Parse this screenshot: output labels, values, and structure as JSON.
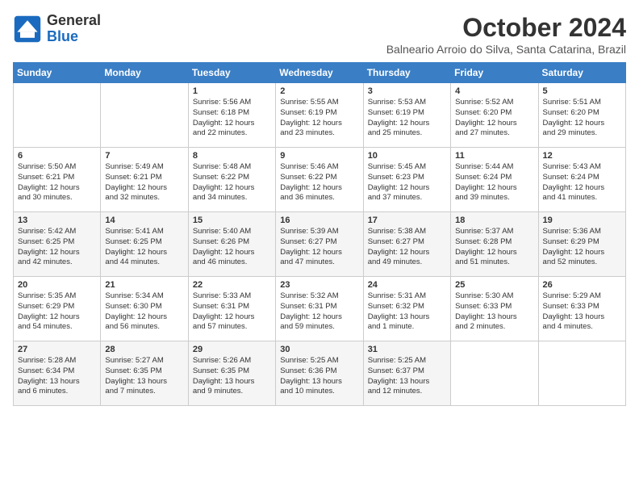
{
  "header": {
    "logo_text_general": "General",
    "logo_text_blue": "Blue",
    "month": "October 2024",
    "location": "Balneario Arroio do Silva, Santa Catarina, Brazil"
  },
  "days_of_week": [
    "Sunday",
    "Monday",
    "Tuesday",
    "Wednesday",
    "Thursday",
    "Friday",
    "Saturday"
  ],
  "weeks": [
    [
      {
        "day": "",
        "content": ""
      },
      {
        "day": "",
        "content": ""
      },
      {
        "day": "1",
        "content": "Sunrise: 5:56 AM\nSunset: 6:18 PM\nDaylight: 12 hours\nand 22 minutes."
      },
      {
        "day": "2",
        "content": "Sunrise: 5:55 AM\nSunset: 6:19 PM\nDaylight: 12 hours\nand 23 minutes."
      },
      {
        "day": "3",
        "content": "Sunrise: 5:53 AM\nSunset: 6:19 PM\nDaylight: 12 hours\nand 25 minutes."
      },
      {
        "day": "4",
        "content": "Sunrise: 5:52 AM\nSunset: 6:20 PM\nDaylight: 12 hours\nand 27 minutes."
      },
      {
        "day": "5",
        "content": "Sunrise: 5:51 AM\nSunset: 6:20 PM\nDaylight: 12 hours\nand 29 minutes."
      }
    ],
    [
      {
        "day": "6",
        "content": "Sunrise: 5:50 AM\nSunset: 6:21 PM\nDaylight: 12 hours\nand 30 minutes."
      },
      {
        "day": "7",
        "content": "Sunrise: 5:49 AM\nSunset: 6:21 PM\nDaylight: 12 hours\nand 32 minutes."
      },
      {
        "day": "8",
        "content": "Sunrise: 5:48 AM\nSunset: 6:22 PM\nDaylight: 12 hours\nand 34 minutes."
      },
      {
        "day": "9",
        "content": "Sunrise: 5:46 AM\nSunset: 6:22 PM\nDaylight: 12 hours\nand 36 minutes."
      },
      {
        "day": "10",
        "content": "Sunrise: 5:45 AM\nSunset: 6:23 PM\nDaylight: 12 hours\nand 37 minutes."
      },
      {
        "day": "11",
        "content": "Sunrise: 5:44 AM\nSunset: 6:24 PM\nDaylight: 12 hours\nand 39 minutes."
      },
      {
        "day": "12",
        "content": "Sunrise: 5:43 AM\nSunset: 6:24 PM\nDaylight: 12 hours\nand 41 minutes."
      }
    ],
    [
      {
        "day": "13",
        "content": "Sunrise: 5:42 AM\nSunset: 6:25 PM\nDaylight: 12 hours\nand 42 minutes."
      },
      {
        "day": "14",
        "content": "Sunrise: 5:41 AM\nSunset: 6:25 PM\nDaylight: 12 hours\nand 44 minutes."
      },
      {
        "day": "15",
        "content": "Sunrise: 5:40 AM\nSunset: 6:26 PM\nDaylight: 12 hours\nand 46 minutes."
      },
      {
        "day": "16",
        "content": "Sunrise: 5:39 AM\nSunset: 6:27 PM\nDaylight: 12 hours\nand 47 minutes."
      },
      {
        "day": "17",
        "content": "Sunrise: 5:38 AM\nSunset: 6:27 PM\nDaylight: 12 hours\nand 49 minutes."
      },
      {
        "day": "18",
        "content": "Sunrise: 5:37 AM\nSunset: 6:28 PM\nDaylight: 12 hours\nand 51 minutes."
      },
      {
        "day": "19",
        "content": "Sunrise: 5:36 AM\nSunset: 6:29 PM\nDaylight: 12 hours\nand 52 minutes."
      }
    ],
    [
      {
        "day": "20",
        "content": "Sunrise: 5:35 AM\nSunset: 6:29 PM\nDaylight: 12 hours\nand 54 minutes."
      },
      {
        "day": "21",
        "content": "Sunrise: 5:34 AM\nSunset: 6:30 PM\nDaylight: 12 hours\nand 56 minutes."
      },
      {
        "day": "22",
        "content": "Sunrise: 5:33 AM\nSunset: 6:31 PM\nDaylight: 12 hours\nand 57 minutes."
      },
      {
        "day": "23",
        "content": "Sunrise: 5:32 AM\nSunset: 6:31 PM\nDaylight: 12 hours\nand 59 minutes."
      },
      {
        "day": "24",
        "content": "Sunrise: 5:31 AM\nSunset: 6:32 PM\nDaylight: 13 hours\nand 1 minute."
      },
      {
        "day": "25",
        "content": "Sunrise: 5:30 AM\nSunset: 6:33 PM\nDaylight: 13 hours\nand 2 minutes."
      },
      {
        "day": "26",
        "content": "Sunrise: 5:29 AM\nSunset: 6:33 PM\nDaylight: 13 hours\nand 4 minutes."
      }
    ],
    [
      {
        "day": "27",
        "content": "Sunrise: 5:28 AM\nSunset: 6:34 PM\nDaylight: 13 hours\nand 6 minutes."
      },
      {
        "day": "28",
        "content": "Sunrise: 5:27 AM\nSunset: 6:35 PM\nDaylight: 13 hours\nand 7 minutes."
      },
      {
        "day": "29",
        "content": "Sunrise: 5:26 AM\nSunset: 6:35 PM\nDaylight: 13 hours\nand 9 minutes."
      },
      {
        "day": "30",
        "content": "Sunrise: 5:25 AM\nSunset: 6:36 PM\nDaylight: 13 hours\nand 10 minutes."
      },
      {
        "day": "31",
        "content": "Sunrise: 5:25 AM\nSunset: 6:37 PM\nDaylight: 13 hours\nand 12 minutes."
      },
      {
        "day": "",
        "content": ""
      },
      {
        "day": "",
        "content": ""
      }
    ]
  ]
}
